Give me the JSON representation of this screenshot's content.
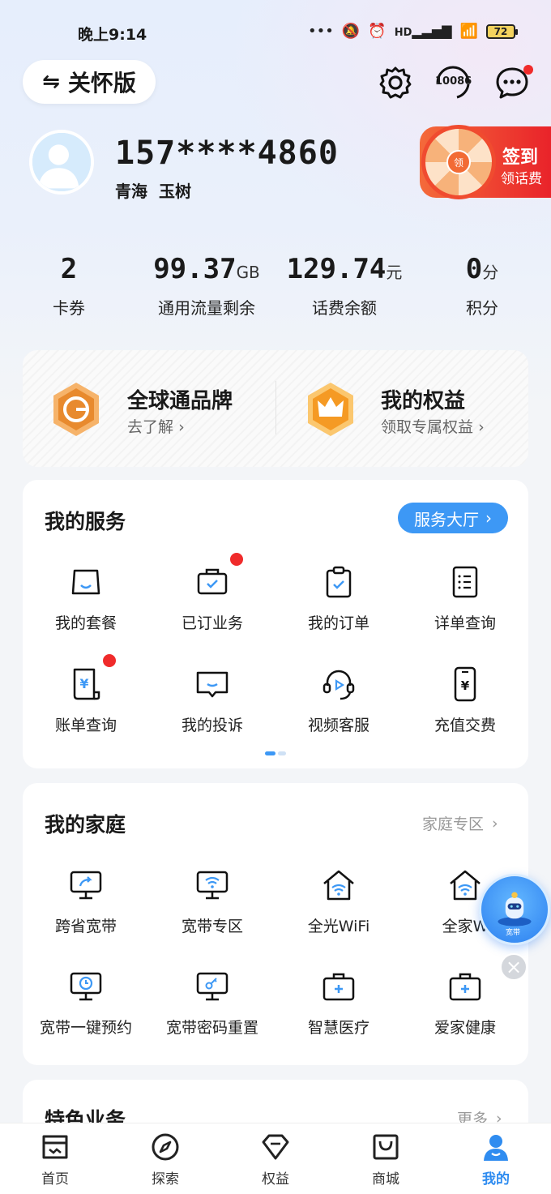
{
  "status_bar": {
    "time": "晚上9:14",
    "battery": "72",
    "signal_label": "HD"
  },
  "header": {
    "care_mode_label": "关怀版",
    "care_mode_icon": "swap-arrows-icon",
    "hotline": "10086"
  },
  "user": {
    "phone": "157****4860",
    "province": "青海",
    "city": "玉树"
  },
  "sign_in": {
    "title": "签到",
    "subtitle": "领话费",
    "wheel_label": "领"
  },
  "stats": [
    {
      "value": "2",
      "unit": "",
      "label": "卡券"
    },
    {
      "value": "99.37",
      "unit": "GB",
      "label": "通用流量剩余"
    },
    {
      "value": "129.74",
      "unit": "元",
      "label": "话费余额"
    },
    {
      "value": "0",
      "unit": "分",
      "label": "积分"
    }
  ],
  "brand": {
    "left": {
      "title": "全球通品牌",
      "subtitle": "去了解"
    },
    "right": {
      "title": "我的权益",
      "subtitle": "领取专属权益"
    }
  },
  "services": {
    "title": "我的服务",
    "hall_button": "服务大厅",
    "items": [
      {
        "label": "我的套餐",
        "icon": "bag-icon"
      },
      {
        "label": "已订业务",
        "icon": "briefcase-check-icon"
      },
      {
        "label": "我的订单",
        "icon": "clipboard-check-icon"
      },
      {
        "label": "详单查询",
        "icon": "list-document-icon"
      },
      {
        "label": "账单查询",
        "icon": "bill-yuan-icon"
      },
      {
        "label": "我的投诉",
        "icon": "chat-box-icon"
      },
      {
        "label": "视频客服",
        "icon": "headset-icon"
      },
      {
        "label": "充值交费",
        "icon": "phone-yuan-icon"
      }
    ]
  },
  "family": {
    "title": "我的家庭",
    "more_link": "家庭专区",
    "items": [
      {
        "label": "跨省宽带",
        "icon": "monitor-share-icon"
      },
      {
        "label": "宽带专区",
        "icon": "monitor-wifi-icon"
      },
      {
        "label": "全光WiFi",
        "icon": "house-wifi-icon"
      },
      {
        "label": "全家W",
        "icon": "house-wifi-icon"
      },
      {
        "label": "宽带一键预约",
        "icon": "monitor-clock-icon"
      },
      {
        "label": "宽带密码重置",
        "icon": "monitor-key-icon"
      },
      {
        "label": "智慧医疗",
        "icon": "medical-kit-icon"
      },
      {
        "label": "爱家健康",
        "icon": "medical-kit-icon"
      }
    ]
  },
  "special": {
    "title": "特色业务",
    "more_link": "更多"
  },
  "floating": {
    "label": "宽带"
  },
  "tabs": [
    {
      "label": "首页",
      "icon": "home-icon"
    },
    {
      "label": "探索",
      "icon": "compass-icon"
    },
    {
      "label": "权益",
      "icon": "diamond-icon"
    },
    {
      "label": "商城",
      "icon": "shop-bag-icon"
    },
    {
      "label": "我的",
      "icon": "user-icon",
      "active": true
    }
  ],
  "colors": {
    "accent": "#3d98f5",
    "red": "#f02b2b",
    "signin": "#e9232a"
  }
}
